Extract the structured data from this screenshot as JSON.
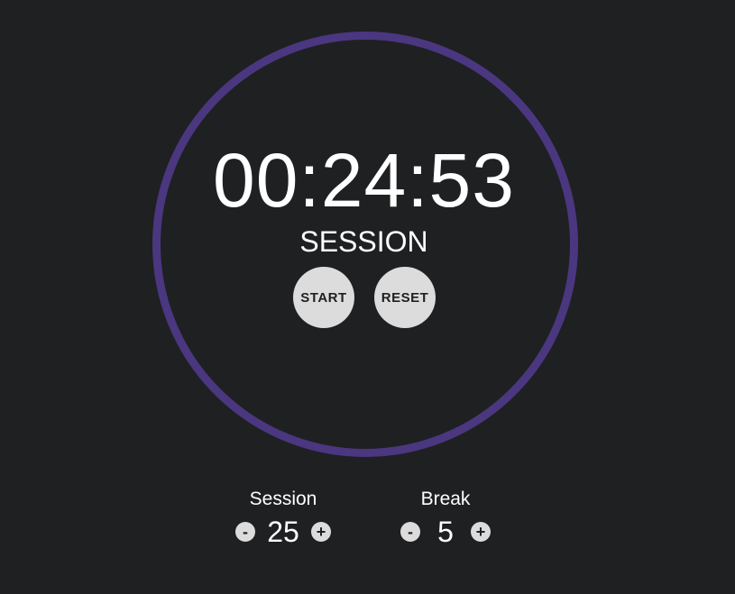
{
  "timer": {
    "display": "00:24:53",
    "mode": "SESSION"
  },
  "controls": {
    "start_label": "START",
    "reset_label": "RESET"
  },
  "session_setting": {
    "label": "Session",
    "value": "25",
    "decrement_label": "-",
    "increment_label": "+"
  },
  "break_setting": {
    "label": "Break",
    "value": "5",
    "decrement_label": "-",
    "increment_label": "+"
  },
  "colors": {
    "background": "#1f2022",
    "ring": "#4a3780",
    "button": "#dcdcdc",
    "text": "#ffffff"
  }
}
